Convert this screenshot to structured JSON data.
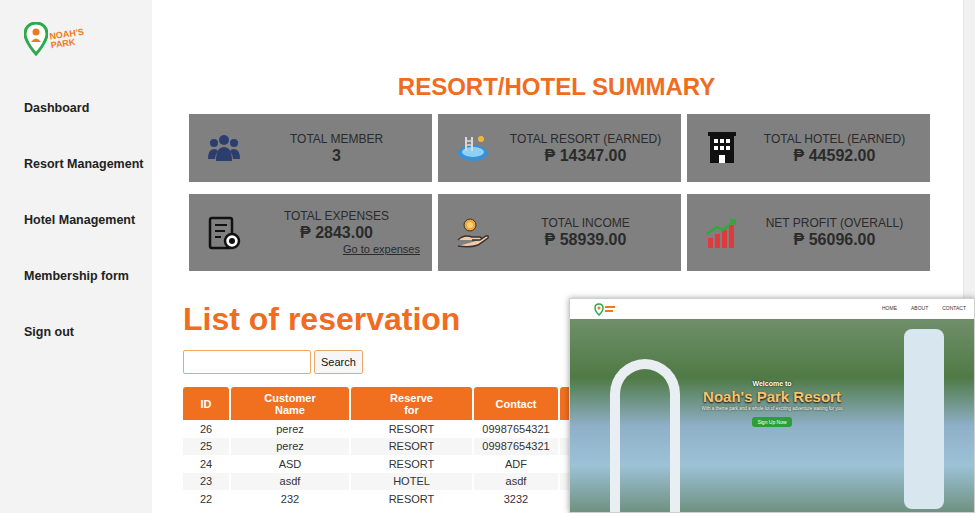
{
  "sidebar": {
    "logo": {
      "line1": "NOAH'S",
      "line2": "PARK"
    },
    "items": [
      {
        "label": "Dashboard"
      },
      {
        "label": "Resort Management"
      },
      {
        "label": "Hotel Management"
      },
      {
        "label": "Membership form"
      },
      {
        "label": "Sign out"
      }
    ]
  },
  "summary": {
    "title": "RESORT/HOTEL SUMMARY",
    "cards": [
      {
        "kind": "members",
        "label": "TOTAL MEMBER",
        "value": "3"
      },
      {
        "kind": "resort",
        "label": "TOTAL RESORT (EARNED)",
        "value": "₱ 14347.00"
      },
      {
        "kind": "hotel",
        "label": "TOTAL HOTEL (EARNED)",
        "value": "₱ 44592.00"
      },
      {
        "kind": "expenses",
        "label": "TOTAL EXPENSES",
        "value": "₱ 2843.00",
        "link": "Go to expenses"
      },
      {
        "kind": "income",
        "label": "TOTAL INCOME",
        "value": "₱ 58939.00"
      },
      {
        "kind": "profit",
        "label": "NET PROFIT (OVERALL)",
        "value": "₱ 56096.00"
      }
    ]
  },
  "reservations": {
    "title": "List of reservation",
    "search": {
      "button": "Search"
    },
    "table": {
      "columns": [
        "ID",
        "Customer Name",
        "Reserve for",
        "Contact"
      ],
      "rows": [
        [
          "26",
          "perez",
          "RESORT",
          "09987654321"
        ],
        [
          "25",
          "perez",
          "RESORT",
          "09987654321"
        ],
        [
          "24",
          "ASD",
          "RESORT",
          "ADF"
        ],
        [
          "23",
          "asdf",
          "HOTEL",
          "asdf"
        ],
        [
          "22",
          "232",
          "RESORT",
          "3232"
        ]
      ]
    }
  },
  "preview": {
    "nav": [
      "HOME",
      "ABOUT",
      "CONTACT"
    ],
    "welcome": "Welcome to",
    "title": "Noah's Park Resort",
    "subtitle": "With a theme park and a whole lot of exciting adventure waiting for you",
    "button": "Sign Up Now"
  }
}
